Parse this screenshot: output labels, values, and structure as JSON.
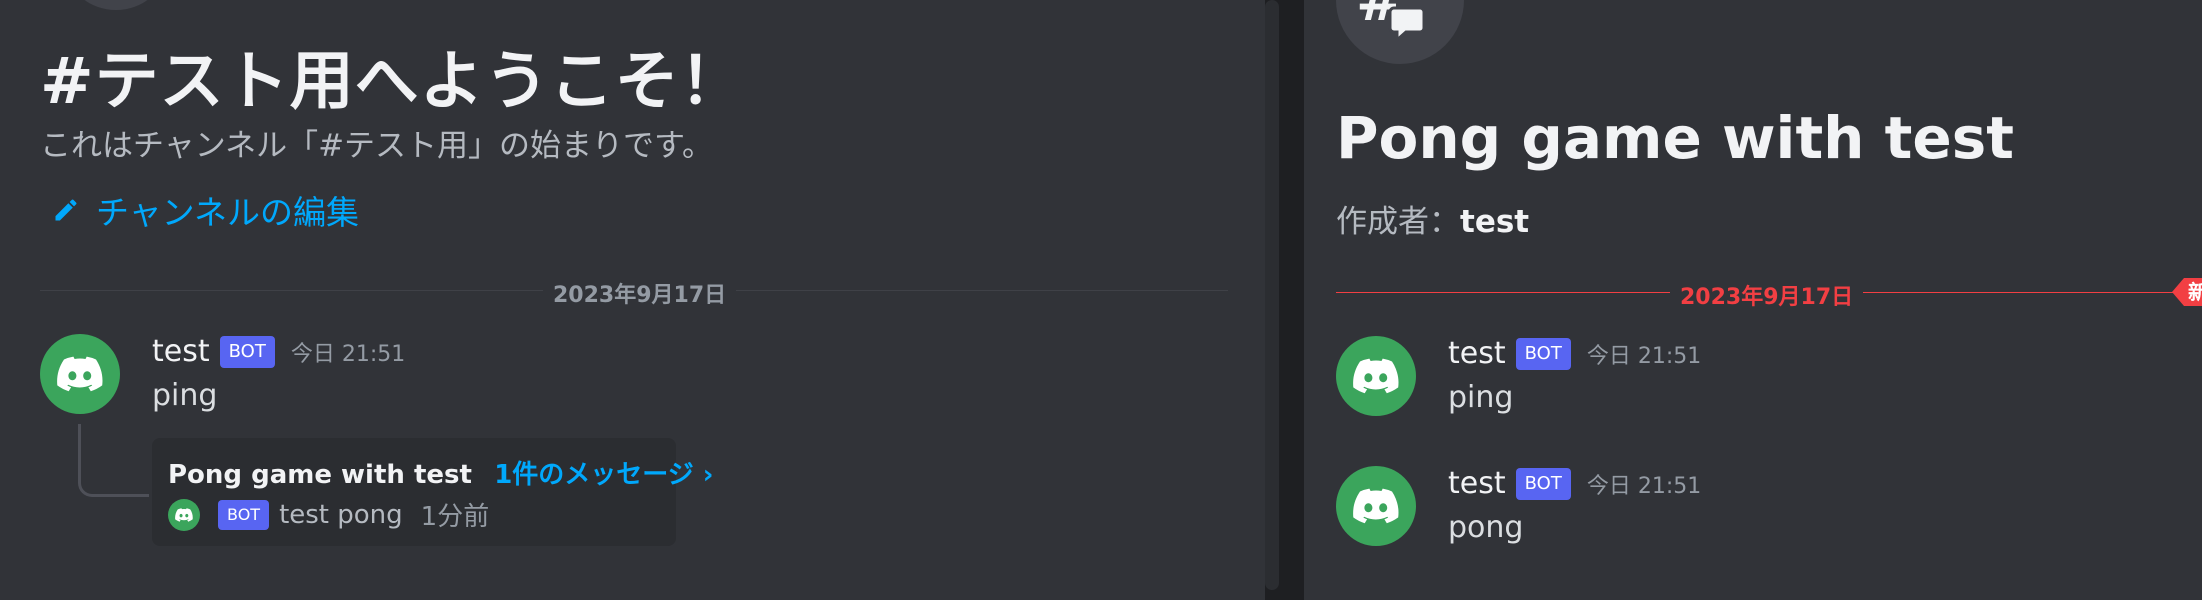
{
  "left": {
    "welcome_title": "#テスト用へようこそ！",
    "welcome_sub": "これはチャンネル「#テスト用」の始まりです。",
    "edit_channel": "チャンネルの編集",
    "date": "2023年9月17日",
    "message": {
      "username": "test",
      "bot_tag": "BOT",
      "timestamp": "今日 21:51",
      "text": "ping"
    },
    "thread": {
      "name": "Pong game with test",
      "count": "1件のメッセージ ›",
      "bot_tag": "BOT",
      "last_message": "test pong",
      "time": "1分前"
    }
  },
  "right": {
    "thread_title": "Pong game with test",
    "author_label": "作成者：",
    "author_name": "test",
    "date": "2023年9月17日",
    "new_badge": "新規",
    "messages": [
      {
        "username": "test",
        "bot_tag": "BOT",
        "timestamp": "今日 21:51",
        "text": "ping"
      },
      {
        "username": "test",
        "bot_tag": "BOT",
        "timestamp": "今日 21:51",
        "text": "pong"
      }
    ]
  },
  "colors": {
    "accent_link": "#00a8fc",
    "bot_tag": "#5865f2",
    "avatar": "#3ba55c",
    "new_marker": "#f23f43"
  },
  "icons": {
    "avatar": "discord-logo-icon",
    "edit": "pencil-icon",
    "thread": "thread-icon"
  }
}
